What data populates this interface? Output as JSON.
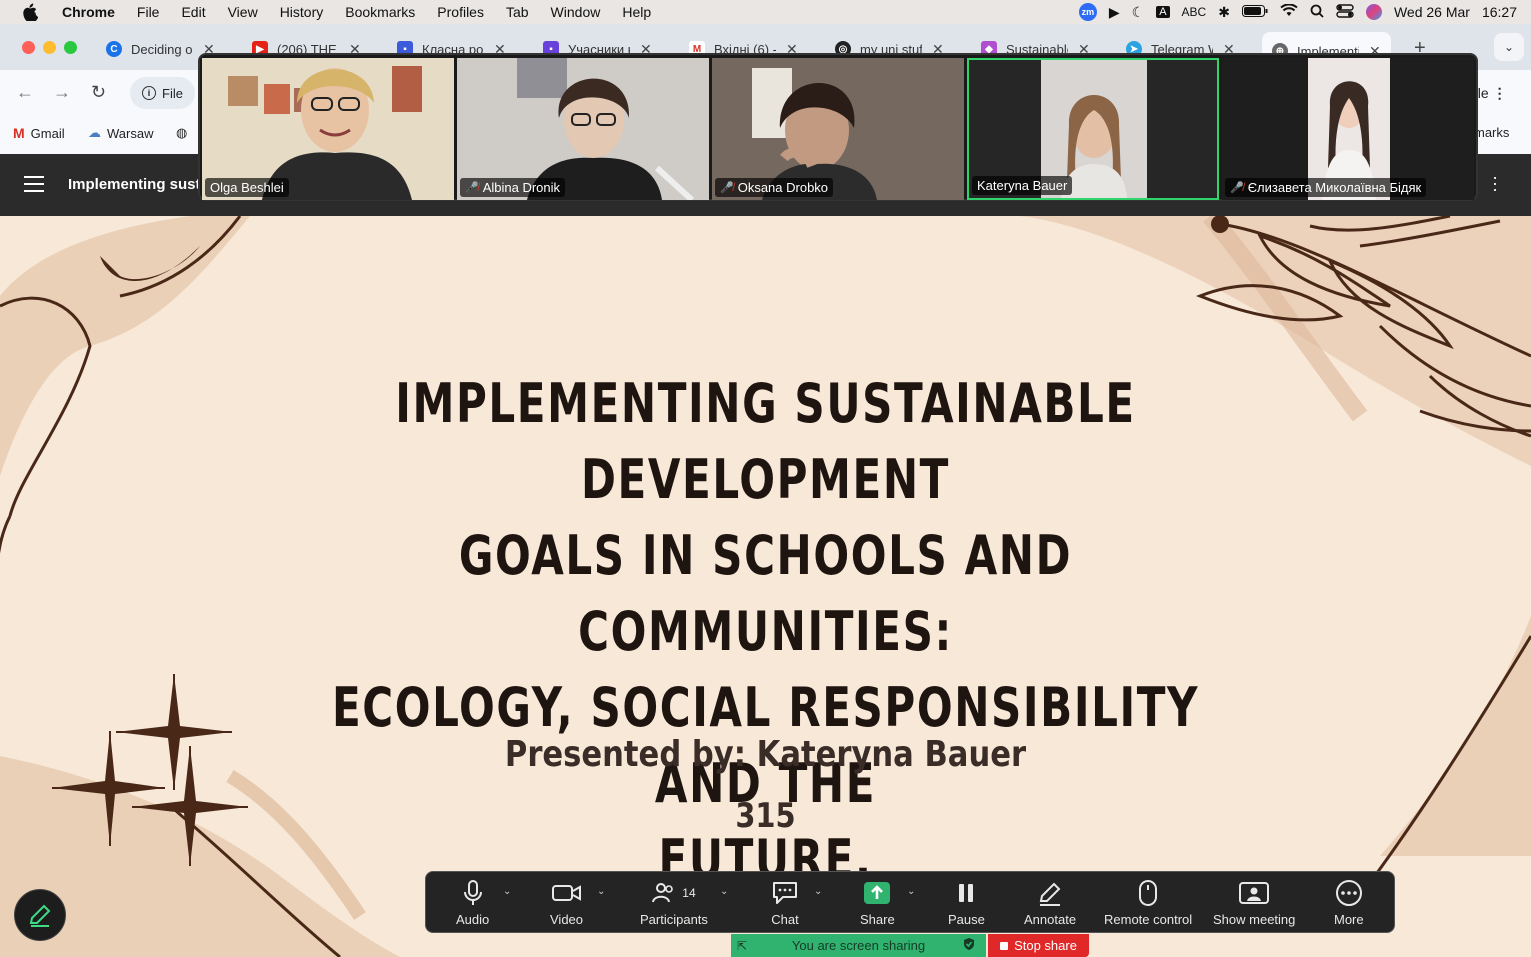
{
  "menubar": {
    "app": "Chrome",
    "items": [
      "File",
      "Edit",
      "View",
      "History",
      "Bookmarks",
      "Profiles",
      "Tab",
      "Window",
      "Help"
    ],
    "status": {
      "keyboard": "ABC",
      "date": "Wed 26 Mar",
      "time": "16:27",
      "zoom_badge": "zm"
    }
  },
  "tabs": [
    {
      "label": "Deciding on",
      "icon": "C",
      "color": "#1a73e8"
    },
    {
      "label": "(206) THE",
      "icon": "▶",
      "color": "#e62117"
    },
    {
      "label": "Класна роб",
      "icon": "▪",
      "color": "#3b5bdb"
    },
    {
      "label": "Учасники к",
      "icon": "▪",
      "color": "#6741d9"
    },
    {
      "label": "Вхідні (6) -",
      "icon": "M",
      "color": "#d93025"
    },
    {
      "label": "my uni stuff",
      "icon": "◎",
      "color": "#222222"
    },
    {
      "label": "Sustainable",
      "icon": "◆",
      "color": "#b04fd0"
    },
    {
      "label": "Telegram W",
      "icon": "➤",
      "color": "#2aa3e0"
    },
    {
      "label": "Implementi",
      "icon": "⊕",
      "color": "#666666"
    }
  ],
  "omnibox": {
    "label": "File"
  },
  "profile_chip": "ble",
  "bookmarks": {
    "items": [
      "Gmail",
      "Warsaw"
    ],
    "overflow": "marks"
  },
  "doc": {
    "title": "Implementing sust"
  },
  "participants": [
    {
      "name": "Olga Beshlei",
      "muted": false,
      "bg": "#c9b79c"
    },
    {
      "name": "Albina Dronik",
      "muted": true,
      "bg": "#bdb7b0"
    },
    {
      "name": "Oksana Drobko",
      "muted": true,
      "bg": "#6b5e54"
    },
    {
      "name": "Kateryna Bauer",
      "muted": false,
      "bg": "#2a2a2a"
    },
    {
      "name": "Єлизавета Миколаївна Бідяк",
      "muted": true,
      "bg": "#1e1e1e"
    }
  ],
  "slide": {
    "title_lines": [
      "IMPLEMENTING SUSTAINABLE DEVELOPMENT",
      "GOALS IN SCHOOLS AND COMMUNITIES:",
      "ECOLOGY, SOCIAL RESPONSIBILITY AND THE",
      "FUTURE."
    ],
    "presenter": "Presented by: Kateryna Bauer",
    "room": "315"
  },
  "toolbar": {
    "audio": "Audio",
    "video": "Video",
    "participants": "Participants",
    "participants_count": "14",
    "chat": "Chat",
    "share": "Share",
    "pause": "Pause",
    "annotate": "Annotate",
    "remote_control": "Remote control",
    "show_meeting": "Show meeting",
    "more": "More"
  },
  "sharing": {
    "status": "You are screen sharing",
    "stop": "Stop share"
  },
  "colors": {
    "slide_bg": "#f7e8d8",
    "slide_text": "#1e1410",
    "accent_brown": "#5a3423",
    "share_green": "#2fb36f",
    "stop_red": "#e02828"
  }
}
